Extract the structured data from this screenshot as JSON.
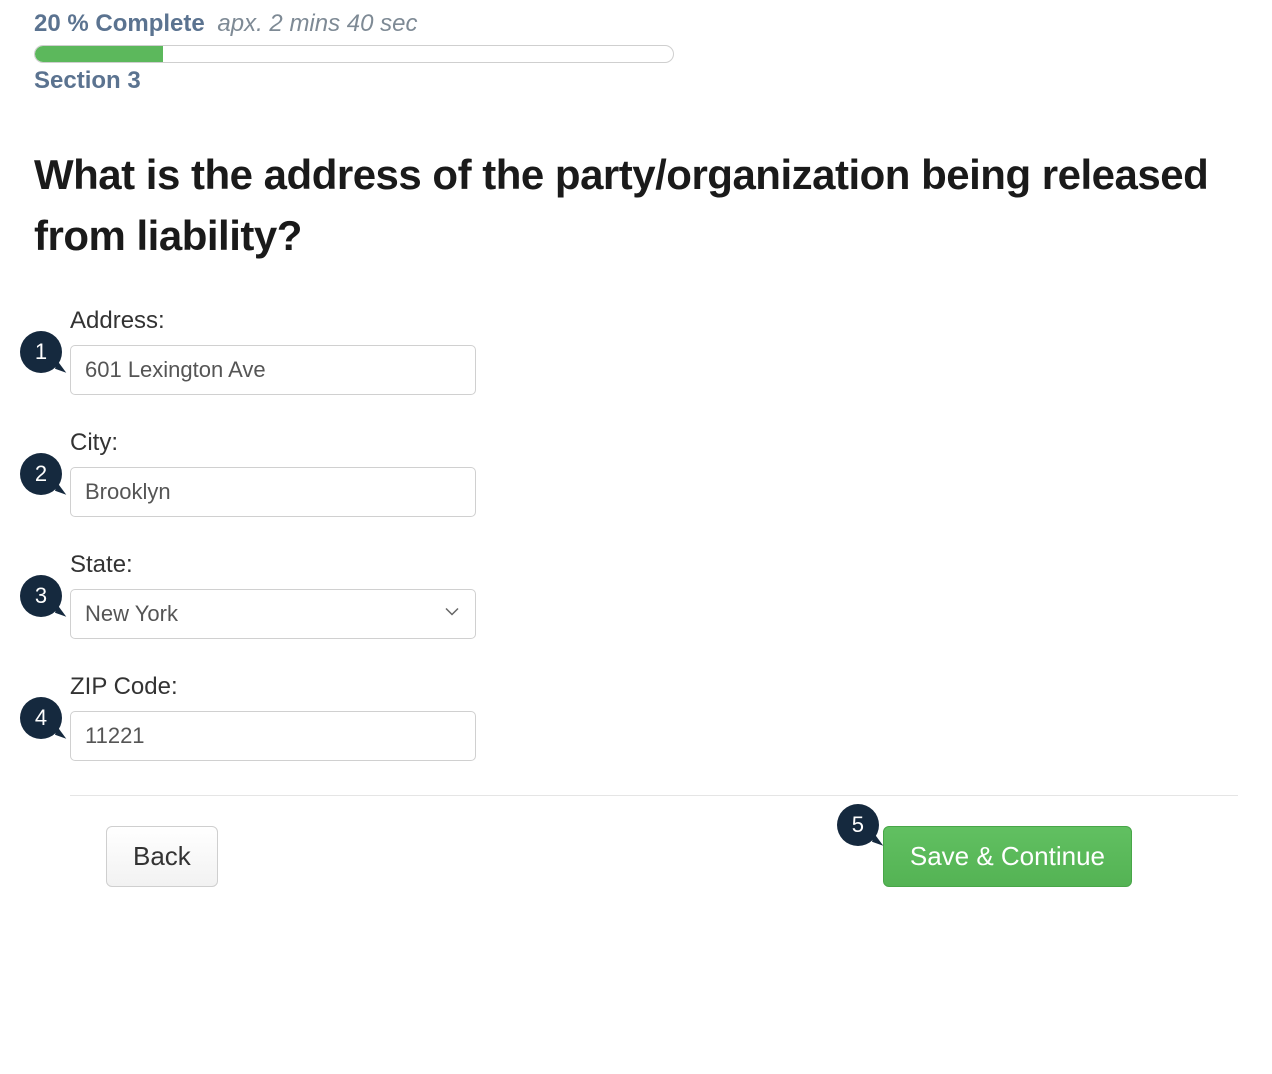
{
  "progress": {
    "percent_text": "20 % Complete",
    "apx_text": "apx. 2 mins 40 sec",
    "percent_value": 20,
    "section_label": "Section 3"
  },
  "question": "What is the address of the party/organization being released from liability?",
  "fields": {
    "address": {
      "label": "Address:",
      "value": "601 Lexington Ave",
      "step": "1"
    },
    "city": {
      "label": "City:",
      "value": "Brooklyn",
      "step": "2"
    },
    "state": {
      "label": "State:",
      "value": "New York",
      "step": "3"
    },
    "zip": {
      "label": "ZIP Code:",
      "value": "11221",
      "step": "4"
    }
  },
  "buttons": {
    "back": "Back",
    "save": "Save & Continue",
    "save_step": "5"
  }
}
